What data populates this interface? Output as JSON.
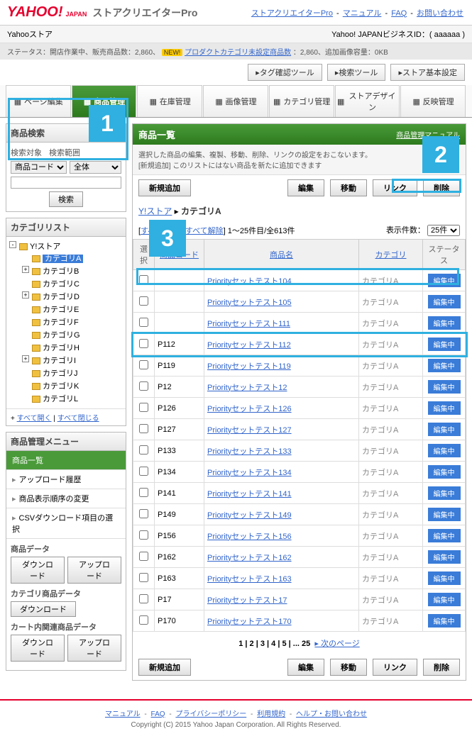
{
  "logo": {
    "yahoo": "YAHOO!",
    "japan": "JAPAN",
    "title": "ストアクリエイターPro"
  },
  "header_links": [
    "ストアクリエイターPro",
    "マニュアル",
    "FAQ",
    "お問い合わせ"
  ],
  "subheader": {
    "left": "Yahooストア",
    "right": "Yahoo! JAPANビジネスID：( aaaaaa )"
  },
  "statusbar": {
    "text1": "ステータス：開店作業中、販売商品数：2,860、",
    "new": "NEW!",
    "link": "プロダクトカテゴリ未設定商品数",
    "text2": "：2,860、追加画像容量：0KB"
  },
  "tool_buttons": [
    "▸タグ確認ツール",
    "▸検索ツール",
    "▸ストア基本設定"
  ],
  "tabs": [
    {
      "label": "ページ編集"
    },
    {
      "label": "商品管理",
      "active": true
    },
    {
      "label": "在庫管理"
    },
    {
      "label": "画像管理"
    },
    {
      "label": "カテゴリ管理"
    },
    {
      "label": "ストアデザイン"
    },
    {
      "label": "反映管理"
    }
  ],
  "search": {
    "title": "商品検索",
    "target_label": "検索対象",
    "range_label": "検索範囲",
    "target_value": "商品コード",
    "range_value": "全体",
    "button": "検索"
  },
  "category_list": {
    "title": "カテゴリリスト",
    "root": "Y!ストア",
    "items": [
      "カテゴリA",
      "カテゴリB",
      "カテゴリC",
      "カテゴリD",
      "カテゴリE",
      "カテゴリF",
      "カテゴリG",
      "カテゴリH",
      "カテゴリI",
      "カテゴリJ",
      "カテゴリK",
      "カテゴリL"
    ],
    "footer_open": "すべて開く",
    "footer_close": "すべて閉じる"
  },
  "menu": {
    "title": "商品管理メニュー",
    "items": [
      "商品一覧",
      "アップロード履歴",
      "商品表示順序の変更",
      "CSVダウンロード項目の選択"
    ]
  },
  "data_sections": [
    {
      "title": "商品データ",
      "buttons": [
        "ダウンロード",
        "アップロード"
      ]
    },
    {
      "title": "カテゴリ商品データ",
      "buttons": [
        "ダウンロード"
      ]
    },
    {
      "title": "カート内関連商品データ",
      "buttons": [
        "ダウンロード",
        "アップロード"
      ]
    }
  ],
  "content": {
    "title": "商品一覧",
    "manual_link": "商品管理マニュアル",
    "desc1": "選択した商品の編集、複製、移動、削除、リンクの設定をおこないます。",
    "desc2": "[新規追加] このリストにはない商品を新たに追加できます",
    "actions": {
      "add": "新規追加",
      "edit": "編集",
      "move": "移動",
      "link": "リンク",
      "delete": "削除"
    },
    "breadcrumb": {
      "root": "Y!ストア",
      "current": "カテゴリA"
    },
    "list_info": {
      "select_all": "すべて選択",
      "deselect_all": "すべて解除",
      "range": "1～25件目/全613件"
    },
    "display_count": {
      "label": "表示件数：",
      "value": "25件"
    },
    "columns": {
      "select": "選択",
      "code": "商品コード",
      "name": "商品名",
      "category": "カテゴリ",
      "status": "ステータス"
    },
    "rows": [
      {
        "code": "",
        "name": "Priorityセットテスト104",
        "cat": "カテゴリA",
        "status": "編集中"
      },
      {
        "code": "",
        "name": "Priorityセットテスト105",
        "cat": "カテゴリA",
        "status": "編集中"
      },
      {
        "code": "",
        "name": "Priorityセットテスト111",
        "cat": "カテゴリA",
        "status": "編集中"
      },
      {
        "code": "P112",
        "name": "Priorityセットテスト112",
        "cat": "カテゴリA",
        "status": "編集中",
        "highlight": true
      },
      {
        "code": "P119",
        "name": "Priorityセットテスト119",
        "cat": "カテゴリA",
        "status": "編集中"
      },
      {
        "code": "P12",
        "name": "Priorityセットテスト12",
        "cat": "カテゴリA",
        "status": "編集中"
      },
      {
        "code": "P126",
        "name": "Priorityセットテスト126",
        "cat": "カテゴリA",
        "status": "編集中"
      },
      {
        "code": "P127",
        "name": "Priorityセットテスト127",
        "cat": "カテゴリA",
        "status": "編集中"
      },
      {
        "code": "P133",
        "name": "Priorityセットテスト133",
        "cat": "カテゴリA",
        "status": "編集中"
      },
      {
        "code": "P134",
        "name": "Priorityセットテスト134",
        "cat": "カテゴリA",
        "status": "編集中"
      },
      {
        "code": "P141",
        "name": "Priorityセットテスト141",
        "cat": "カテゴリA",
        "status": "編集中"
      },
      {
        "code": "P149",
        "name": "Priorityセットテスト149",
        "cat": "カテゴリA",
        "status": "編集中"
      },
      {
        "code": "P156",
        "name": "Priorityセットテスト156",
        "cat": "カテゴリA",
        "status": "編集中"
      },
      {
        "code": "P162",
        "name": "Priorityセットテスト162",
        "cat": "カテゴリA",
        "status": "編集中"
      },
      {
        "code": "P163",
        "name": "Priorityセットテスト163",
        "cat": "カテゴリA",
        "status": "編集中"
      },
      {
        "code": "P17",
        "name": "Priorityセットテスト17",
        "cat": "カテゴリA",
        "status": "編集中"
      },
      {
        "code": "P170",
        "name": "Priorityセットテスト170",
        "cat": "カテゴリA",
        "status": "編集中"
      }
    ],
    "pagination": {
      "pages": "1 | 2 | 3 | 4 | 5 | ... 25",
      "next": "▸ 次のページ"
    }
  },
  "footer": {
    "links": [
      "マニュアル",
      "FAQ",
      "プライバシーポリシー",
      "利用規約",
      "ヘルプ・お問い合わせ"
    ],
    "copyright": "Copyright (C) 2015 Yahoo Japan Corporation. All Rights Reserved."
  },
  "callouts": {
    "one": "1",
    "two": "2",
    "three": "3"
  }
}
